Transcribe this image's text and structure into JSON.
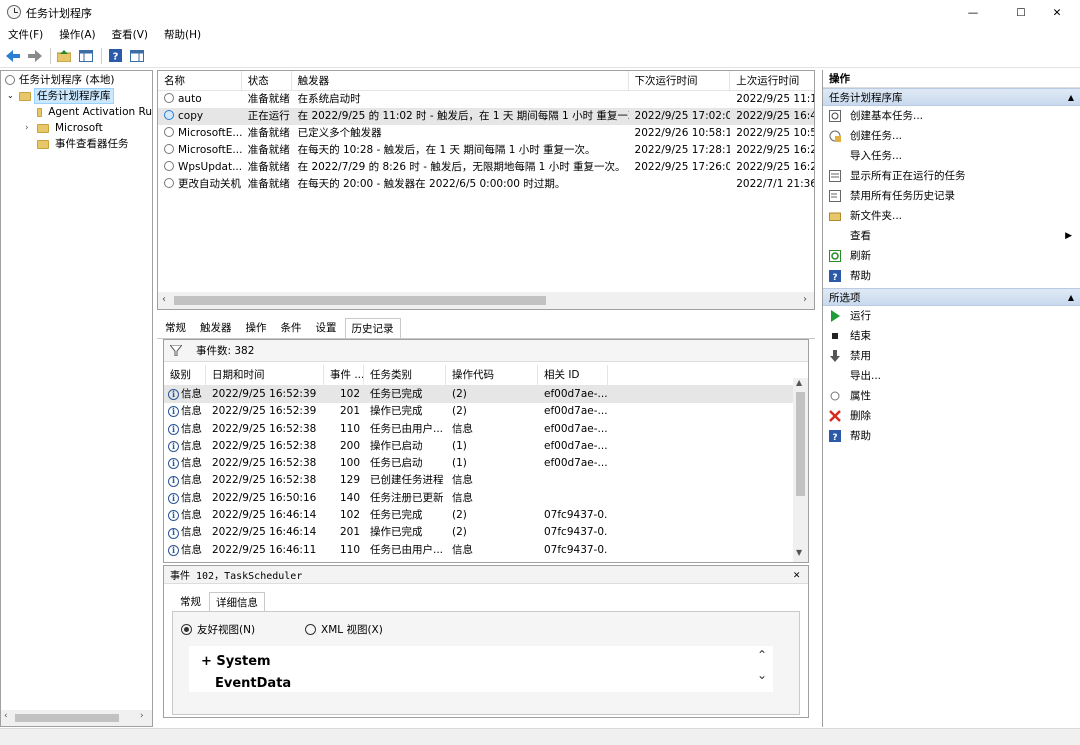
{
  "window": {
    "title": "任务计划程序",
    "minimize": "—",
    "maximize": "☐",
    "close": "✕"
  },
  "menu": [
    "文件(F)",
    "操作(A)",
    "查看(V)",
    "帮助(H)"
  ],
  "tree": {
    "root": "任务计划程序 (本地)",
    "library": "任务计划程序库",
    "children": [
      "Agent Activation Ru",
      "Microsoft",
      "事件查看器任务"
    ]
  },
  "tasklist": {
    "columns": [
      "名称",
      "状态",
      "触发器",
      "下次运行时间",
      "上次运行时间"
    ],
    "rows": [
      {
        "name": "auto",
        "status": "准备就绪",
        "trigger": "在系统启动时",
        "next": "",
        "last": "2022/9/25 11:11"
      },
      {
        "name": "copy",
        "status": "正在运行",
        "trigger": "在 2022/9/25 的 11:02 时 - 触发后，在 1 天 期间每隔 1 小时 重复一次。",
        "next": "2022/9/25 17:02:00",
        "last": "2022/9/25 16:46"
      },
      {
        "name": "MicrosoftE...",
        "status": "准备就绪",
        "trigger": "已定义多个触发器",
        "next": "2022/9/26 10:58:14",
        "last": "2022/9/25 10:58"
      },
      {
        "name": "MicrosoftE...",
        "status": "准备就绪",
        "trigger": "在每天的 10:28 - 触发后，在 1 天 期间每隔 1 小时 重复一次。",
        "next": "2022/9/25 17:28:14",
        "last": "2022/9/25 16:28"
      },
      {
        "name": "WpsUpdat...",
        "status": "准备就绪",
        "trigger": "在 2022/7/29 的 8:26 时 - 触发后，无限期地每隔 1 小时 重复一次。",
        "next": "2022/9/25 17:26:04",
        "last": "2022/9/25 16:26"
      },
      {
        "name": "更改自动关机",
        "status": "准备就绪",
        "trigger": "在每天的 20:00 - 触发器在 2022/6/5 0:00:00 时过期。",
        "next": "",
        "last": "2022/7/1 21:36:5"
      }
    ]
  },
  "tabs": [
    "常规",
    "触发器",
    "操作",
    "条件",
    "设置",
    "历史记录"
  ],
  "history": {
    "event_count": "事件数: 382",
    "columns": [
      "级别",
      "日期和时间",
      "事件 ...",
      "任务类别",
      "操作代码",
      "相关 ID"
    ],
    "rows": [
      {
        "level": "信息",
        "time": "2022/9/25 16:52:39",
        "id": "102",
        "category": "任务已完成",
        "opcode": "(2)",
        "rel": "ef00d7ae-..."
      },
      {
        "level": "信息",
        "time": "2022/9/25 16:52:39",
        "id": "201",
        "category": "操作已完成",
        "opcode": "(2)",
        "rel": "ef00d7ae-..."
      },
      {
        "level": "信息",
        "time": "2022/9/25 16:52:38",
        "id": "110",
        "category": "任务已由用户...",
        "opcode": "信息",
        "rel": "ef00d7ae-..."
      },
      {
        "level": "信息",
        "time": "2022/9/25 16:52:38",
        "id": "200",
        "category": "操作已启动",
        "opcode": "(1)",
        "rel": "ef00d7ae-..."
      },
      {
        "level": "信息",
        "time": "2022/9/25 16:52:38",
        "id": "100",
        "category": "任务已启动",
        "opcode": "(1)",
        "rel": "ef00d7ae-..."
      },
      {
        "level": "信息",
        "time": "2022/9/25 16:52:38",
        "id": "129",
        "category": "已创建任务进程",
        "opcode": "信息",
        "rel": ""
      },
      {
        "level": "信息",
        "time": "2022/9/25 16:50:16",
        "id": "140",
        "category": "任务注册已更新",
        "opcode": "信息",
        "rel": ""
      },
      {
        "level": "信息",
        "time": "2022/9/25 16:46:14",
        "id": "102",
        "category": "任务已完成",
        "opcode": "(2)",
        "rel": "07fc9437-0..."
      },
      {
        "level": "信息",
        "time": "2022/9/25 16:46:14",
        "id": "201",
        "category": "操作已完成",
        "opcode": "(2)",
        "rel": "07fc9437-0..."
      },
      {
        "level": "信息",
        "time": "2022/9/25 16:46:11",
        "id": "110",
        "category": "任务已由用户...",
        "opcode": "信息",
        "rel": "07fc9437-0..."
      }
    ]
  },
  "detail": {
    "title": "事件 102，TaskScheduler",
    "tabs": [
      "常规",
      "详细信息"
    ],
    "radio_friendly": "友好视图(N)",
    "radio_xml": "XML 视图(X)",
    "tree_system": "+ System",
    "tree_eventdata": "EventData"
  },
  "actions": {
    "header": "操作",
    "section1": "任务计划程序库",
    "items1": [
      "创建基本任务...",
      "创建任务...",
      "导入任务...",
      "显示所有正在运行的任务",
      "禁用所有任务历史记录",
      "新文件夹...",
      "查看",
      "刷新",
      "帮助"
    ],
    "section2": "所选项",
    "items2": [
      "运行",
      "结束",
      "禁用",
      "导出...",
      "属性",
      "删除",
      "帮助"
    ]
  },
  "colors": {
    "accent": "#0078d7",
    "section_bg": "#d3e1f1",
    "run_green": "#1e9e3a",
    "delete_red": "#d62b1f",
    "help_blue": "#2a5aa8"
  }
}
